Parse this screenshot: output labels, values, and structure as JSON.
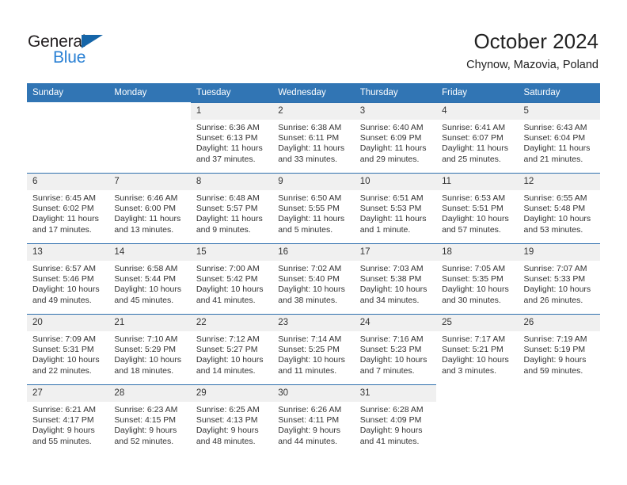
{
  "brand": {
    "name_top": "General",
    "name_bottom": "Blue",
    "triangle_color": "#1565a8",
    "blue_color": "#2980d4"
  },
  "header": {
    "title": "October 2024",
    "subtitle": "Chynow, Mazovia, Poland"
  },
  "theme": {
    "header_blue": "#3175b4",
    "row_rule_blue": "#2f6fad",
    "daynum_band": "#f0f0f0",
    "text": "#333333"
  },
  "labels": {
    "sunrise": "Sunrise:",
    "sunset": "Sunset:",
    "daylight": "Daylight:"
  },
  "weekdays": [
    "Sunday",
    "Monday",
    "Tuesday",
    "Wednesday",
    "Thursday",
    "Friday",
    "Saturday"
  ],
  "weeks": [
    [
      {
        "empty": true
      },
      {
        "empty": true
      },
      {
        "day": "1",
        "sunrise": "Sunrise: 6:36 AM",
        "sunset": "Sunset: 6:13 PM",
        "daylight": "Daylight: 11 hours and 37 minutes."
      },
      {
        "day": "2",
        "sunrise": "Sunrise: 6:38 AM",
        "sunset": "Sunset: 6:11 PM",
        "daylight": "Daylight: 11 hours and 33 minutes."
      },
      {
        "day": "3",
        "sunrise": "Sunrise: 6:40 AM",
        "sunset": "Sunset: 6:09 PM",
        "daylight": "Daylight: 11 hours and 29 minutes."
      },
      {
        "day": "4",
        "sunrise": "Sunrise: 6:41 AM",
        "sunset": "Sunset: 6:07 PM",
        "daylight": "Daylight: 11 hours and 25 minutes."
      },
      {
        "day": "5",
        "sunrise": "Sunrise: 6:43 AM",
        "sunset": "Sunset: 6:04 PM",
        "daylight": "Daylight: 11 hours and 21 minutes."
      }
    ],
    [
      {
        "day": "6",
        "sunrise": "Sunrise: 6:45 AM",
        "sunset": "Sunset: 6:02 PM",
        "daylight": "Daylight: 11 hours and 17 minutes."
      },
      {
        "day": "7",
        "sunrise": "Sunrise: 6:46 AM",
        "sunset": "Sunset: 6:00 PM",
        "daylight": "Daylight: 11 hours and 13 minutes."
      },
      {
        "day": "8",
        "sunrise": "Sunrise: 6:48 AM",
        "sunset": "Sunset: 5:57 PM",
        "daylight": "Daylight: 11 hours and 9 minutes."
      },
      {
        "day": "9",
        "sunrise": "Sunrise: 6:50 AM",
        "sunset": "Sunset: 5:55 PM",
        "daylight": "Daylight: 11 hours and 5 minutes."
      },
      {
        "day": "10",
        "sunrise": "Sunrise: 6:51 AM",
        "sunset": "Sunset: 5:53 PM",
        "daylight": "Daylight: 11 hours and 1 minute."
      },
      {
        "day": "11",
        "sunrise": "Sunrise: 6:53 AM",
        "sunset": "Sunset: 5:51 PM",
        "daylight": "Daylight: 10 hours and 57 minutes."
      },
      {
        "day": "12",
        "sunrise": "Sunrise: 6:55 AM",
        "sunset": "Sunset: 5:48 PM",
        "daylight": "Daylight: 10 hours and 53 minutes."
      }
    ],
    [
      {
        "day": "13",
        "sunrise": "Sunrise: 6:57 AM",
        "sunset": "Sunset: 5:46 PM",
        "daylight": "Daylight: 10 hours and 49 minutes."
      },
      {
        "day": "14",
        "sunrise": "Sunrise: 6:58 AM",
        "sunset": "Sunset: 5:44 PM",
        "daylight": "Daylight: 10 hours and 45 minutes."
      },
      {
        "day": "15",
        "sunrise": "Sunrise: 7:00 AM",
        "sunset": "Sunset: 5:42 PM",
        "daylight": "Daylight: 10 hours and 41 minutes."
      },
      {
        "day": "16",
        "sunrise": "Sunrise: 7:02 AM",
        "sunset": "Sunset: 5:40 PM",
        "daylight": "Daylight: 10 hours and 38 minutes."
      },
      {
        "day": "17",
        "sunrise": "Sunrise: 7:03 AM",
        "sunset": "Sunset: 5:38 PM",
        "daylight": "Daylight: 10 hours and 34 minutes."
      },
      {
        "day": "18",
        "sunrise": "Sunrise: 7:05 AM",
        "sunset": "Sunset: 5:35 PM",
        "daylight": "Daylight: 10 hours and 30 minutes."
      },
      {
        "day": "19",
        "sunrise": "Sunrise: 7:07 AM",
        "sunset": "Sunset: 5:33 PM",
        "daylight": "Daylight: 10 hours and 26 minutes."
      }
    ],
    [
      {
        "day": "20",
        "sunrise": "Sunrise: 7:09 AM",
        "sunset": "Sunset: 5:31 PM",
        "daylight": "Daylight: 10 hours and 22 minutes."
      },
      {
        "day": "21",
        "sunrise": "Sunrise: 7:10 AM",
        "sunset": "Sunset: 5:29 PM",
        "daylight": "Daylight: 10 hours and 18 minutes."
      },
      {
        "day": "22",
        "sunrise": "Sunrise: 7:12 AM",
        "sunset": "Sunset: 5:27 PM",
        "daylight": "Daylight: 10 hours and 14 minutes."
      },
      {
        "day": "23",
        "sunrise": "Sunrise: 7:14 AM",
        "sunset": "Sunset: 5:25 PM",
        "daylight": "Daylight: 10 hours and 11 minutes."
      },
      {
        "day": "24",
        "sunrise": "Sunrise: 7:16 AM",
        "sunset": "Sunset: 5:23 PM",
        "daylight": "Daylight: 10 hours and 7 minutes."
      },
      {
        "day": "25",
        "sunrise": "Sunrise: 7:17 AM",
        "sunset": "Sunset: 5:21 PM",
        "daylight": "Daylight: 10 hours and 3 minutes."
      },
      {
        "day": "26",
        "sunrise": "Sunrise: 7:19 AM",
        "sunset": "Sunset: 5:19 PM",
        "daylight": "Daylight: 9 hours and 59 minutes."
      }
    ],
    [
      {
        "day": "27",
        "sunrise": "Sunrise: 6:21 AM",
        "sunset": "Sunset: 4:17 PM",
        "daylight": "Daylight: 9 hours and 55 minutes."
      },
      {
        "day": "28",
        "sunrise": "Sunrise: 6:23 AM",
        "sunset": "Sunset: 4:15 PM",
        "daylight": "Daylight: 9 hours and 52 minutes."
      },
      {
        "day": "29",
        "sunrise": "Sunrise: 6:25 AM",
        "sunset": "Sunset: 4:13 PM",
        "daylight": "Daylight: 9 hours and 48 minutes."
      },
      {
        "day": "30",
        "sunrise": "Sunrise: 6:26 AM",
        "sunset": "Sunset: 4:11 PM",
        "daylight": "Daylight: 9 hours and 44 minutes."
      },
      {
        "day": "31",
        "sunrise": "Sunrise: 6:28 AM",
        "sunset": "Sunset: 4:09 PM",
        "daylight": "Daylight: 9 hours and 41 minutes."
      },
      {
        "empty": true
      },
      {
        "empty": true
      }
    ]
  ]
}
